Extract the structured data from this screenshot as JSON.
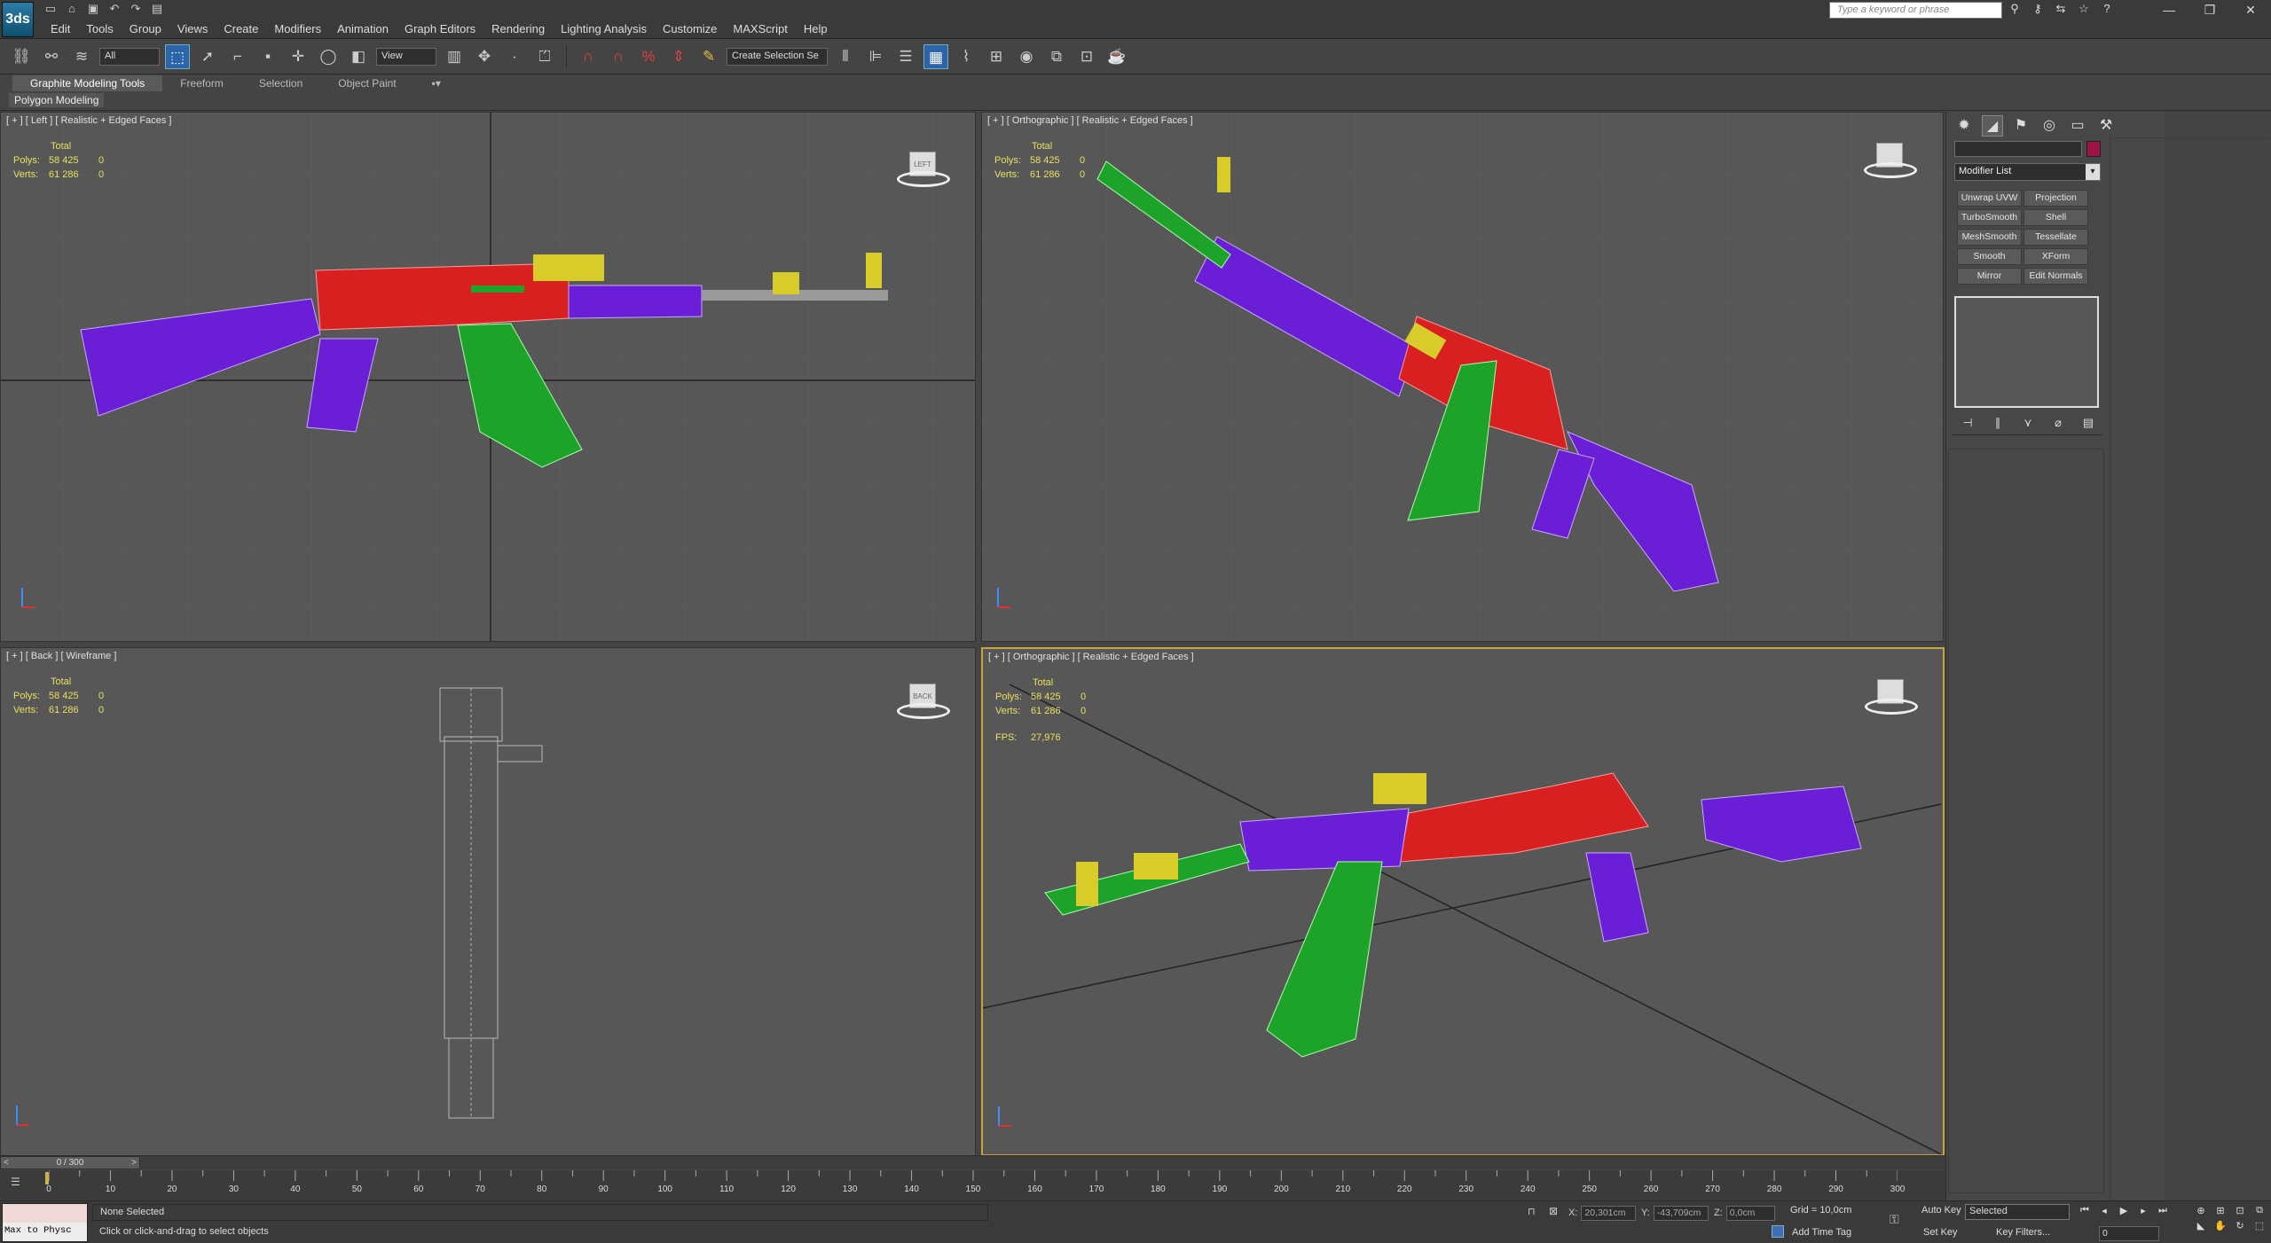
{
  "app": {
    "logo": "3ds",
    "search_placeholder": "Type a keyword or phrase"
  },
  "quick_access": [
    "new-icon",
    "open-icon",
    "save-icon",
    "undo-icon",
    "redo-icon",
    "project-icon"
  ],
  "menu": [
    "Edit",
    "Tools",
    "Group",
    "Views",
    "Create",
    "Modifiers",
    "Animation",
    "Graph Editors",
    "Rendering",
    "Lighting Analysis",
    "Customize",
    "MAXScript",
    "Help"
  ],
  "toolbar": {
    "selection_filter": "All",
    "ref_coord": "View",
    "named_selection": "Create Selection Se"
  },
  "ribbon": {
    "tabs": [
      "Graphite Modeling Tools",
      "Freeform",
      "Selection",
      "Object Paint"
    ],
    "panel": "Polygon Modeling"
  },
  "viewports": [
    {
      "label": "[ + ] [ Left ] [ Realistic + Edged Faces ]",
      "cube": "LEFT"
    },
    {
      "label": "[ + ] [ Orthographic ] [ Realistic + Edged Faces ]",
      "cube": ""
    },
    {
      "label": "[ + ] [ Back ] [ Wireframe ]",
      "cube": "BACK"
    },
    {
      "label": "[ + ] [ Orthographic ] [ Realistic + Edged Faces ]",
      "cube": ""
    }
  ],
  "stats": {
    "header": "Total",
    "polys_label": "Polys:",
    "polys": "58 425",
    "polys_sel": "0",
    "verts_label": "Verts:",
    "verts": "61 286",
    "verts_sel": "0",
    "fps_label": "FPS:",
    "fps": "27,976"
  },
  "command_panel": {
    "modifier_list": "Modifier List",
    "modifiers": [
      "Unwrap UVW",
      "Projection",
      "TurboSmooth",
      "Shell",
      "MeshSmooth",
      "Tessellate",
      "Smooth",
      "XForm",
      "Mirror",
      "Edit Normals"
    ],
    "object_color": "#9a1545"
  },
  "timeline": {
    "frame_display": "0 / 300",
    "prev": "<",
    "next": ">",
    "ticks": [
      "0",
      "10",
      "20",
      "30",
      "40",
      "50",
      "60",
      "70",
      "80",
      "90",
      "100",
      "110",
      "120",
      "130",
      "140",
      "150",
      "160",
      "170",
      "180",
      "190",
      "200",
      "210",
      "220",
      "230",
      "240",
      "250",
      "260",
      "270",
      "280",
      "290",
      "300"
    ]
  },
  "status": {
    "maxscript": "Max to Physc",
    "selection": "None Selected",
    "prompt": "Click or click-and-drag to select objects",
    "x_label": "X:",
    "x": "20,301cm",
    "y_label": "Y:",
    "y": "-43,709cm",
    "z_label": "Z:",
    "z": "0,0cm",
    "grid": "Grid = 10,0cm",
    "add_time_tag": "Add Time Tag",
    "auto_key": "Auto Key",
    "set_key": "Set Key",
    "key_mode": "Selected",
    "key_filters": "Key Filters...",
    "current_frame": "0"
  },
  "colors": {
    "red": "#d82020",
    "purple": "#6a1fd6",
    "green": "#1ea32a",
    "yellow": "#d8cc2a",
    "gray": "#9a9a9a",
    "active_border": "#c7a53a"
  }
}
